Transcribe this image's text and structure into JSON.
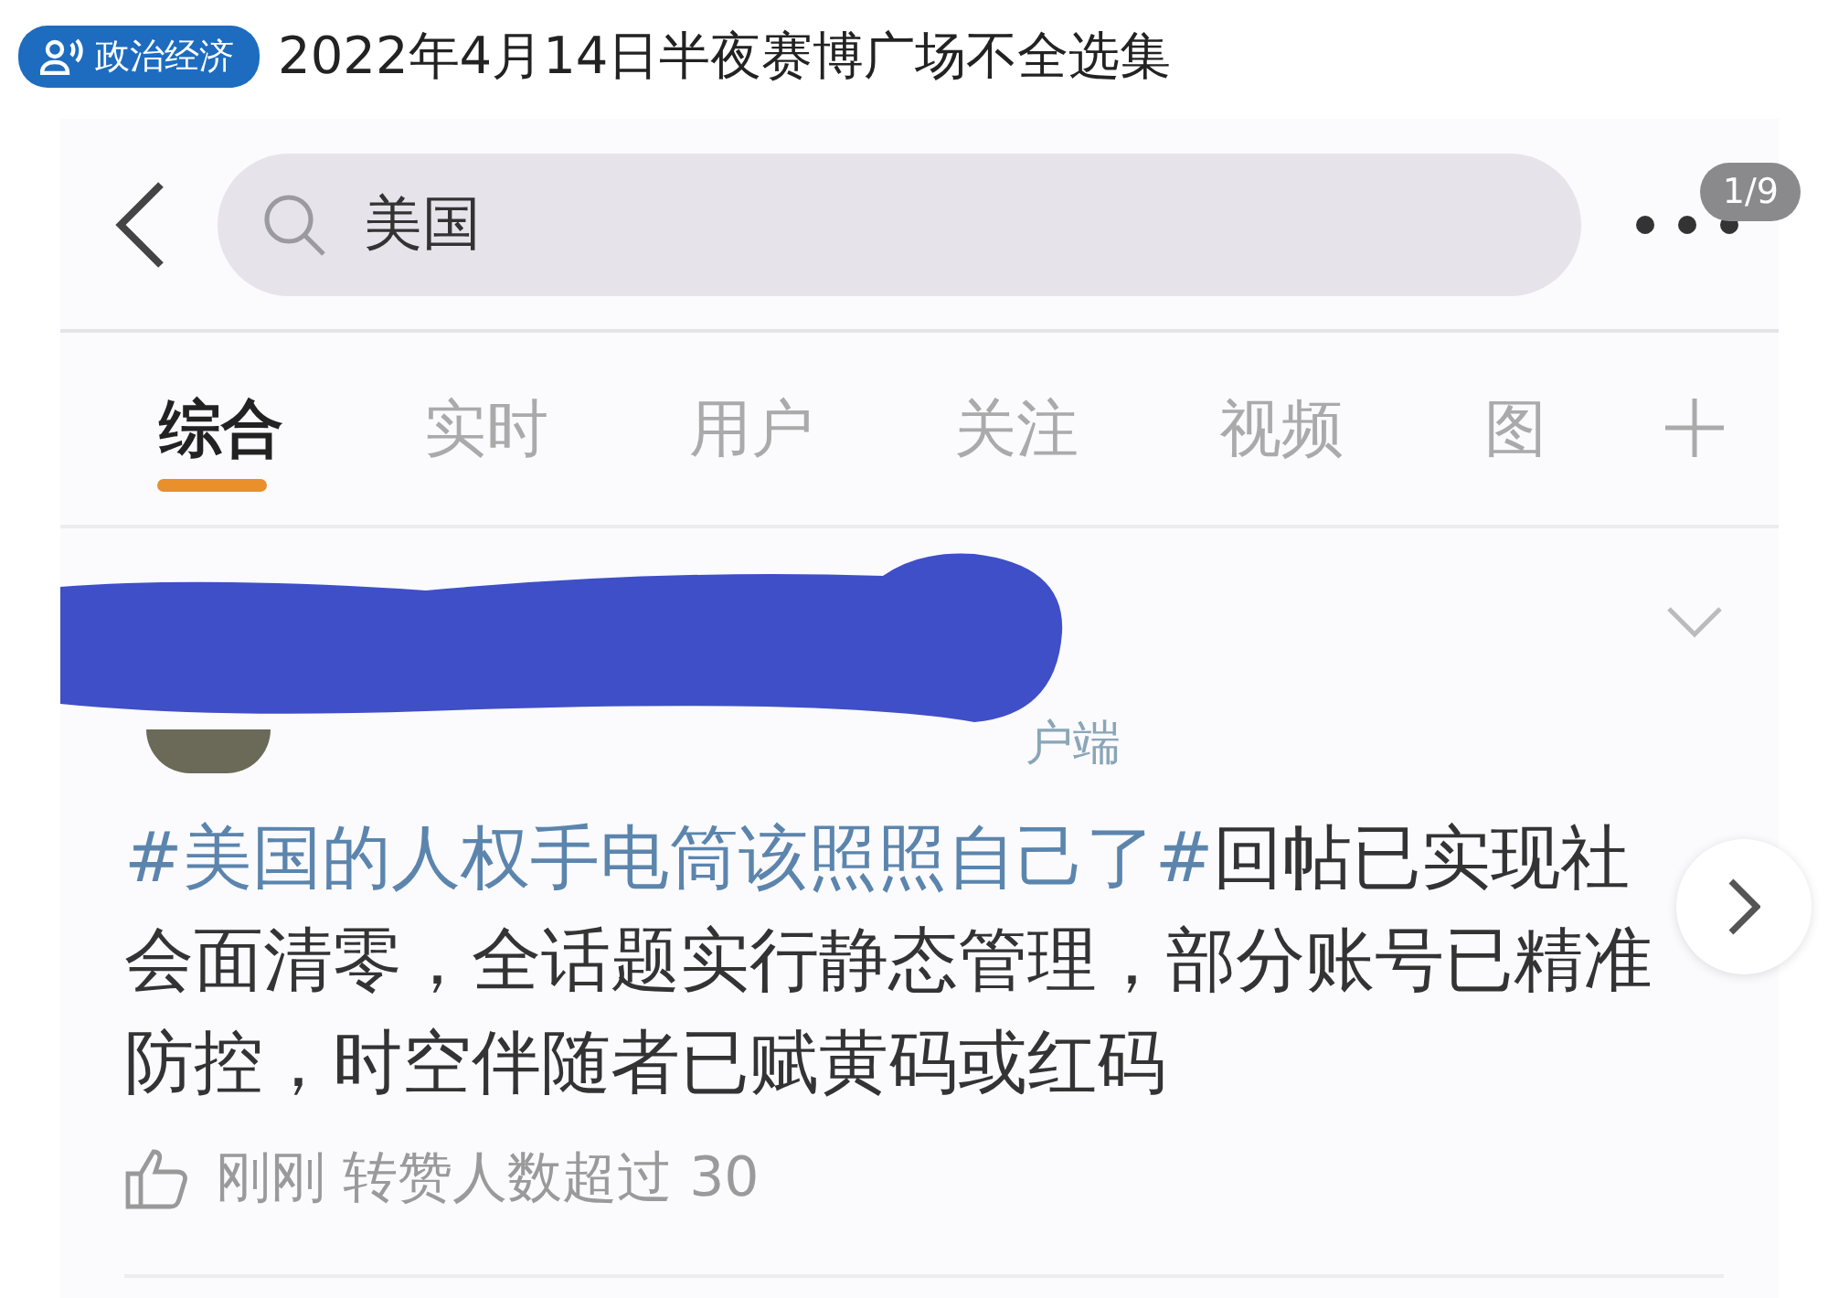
{
  "header": {
    "category": "政治经济",
    "title": "2022年4月14日半夜赛博广场不全选集"
  },
  "search": {
    "value": "美国"
  },
  "image_counter": "1/9",
  "tabs": [
    {
      "label": "综合",
      "selected": true
    },
    {
      "label": "实时",
      "selected": false
    },
    {
      "label": "用户",
      "selected": false
    },
    {
      "label": "关注",
      "selected": false
    },
    {
      "label": "视频",
      "selected": false
    },
    {
      "label": "图",
      "selected": false
    }
  ],
  "post": {
    "meta": "户端",
    "hashtag": "#美国的人权手电筒该照照自己了#",
    "text": "回帖已实现社会面清零，全话题实行静态管理，部分账号已精准防控，时空伴随者已赋黄码或红码",
    "footer": "刚刚 转赞人数超过 30"
  }
}
